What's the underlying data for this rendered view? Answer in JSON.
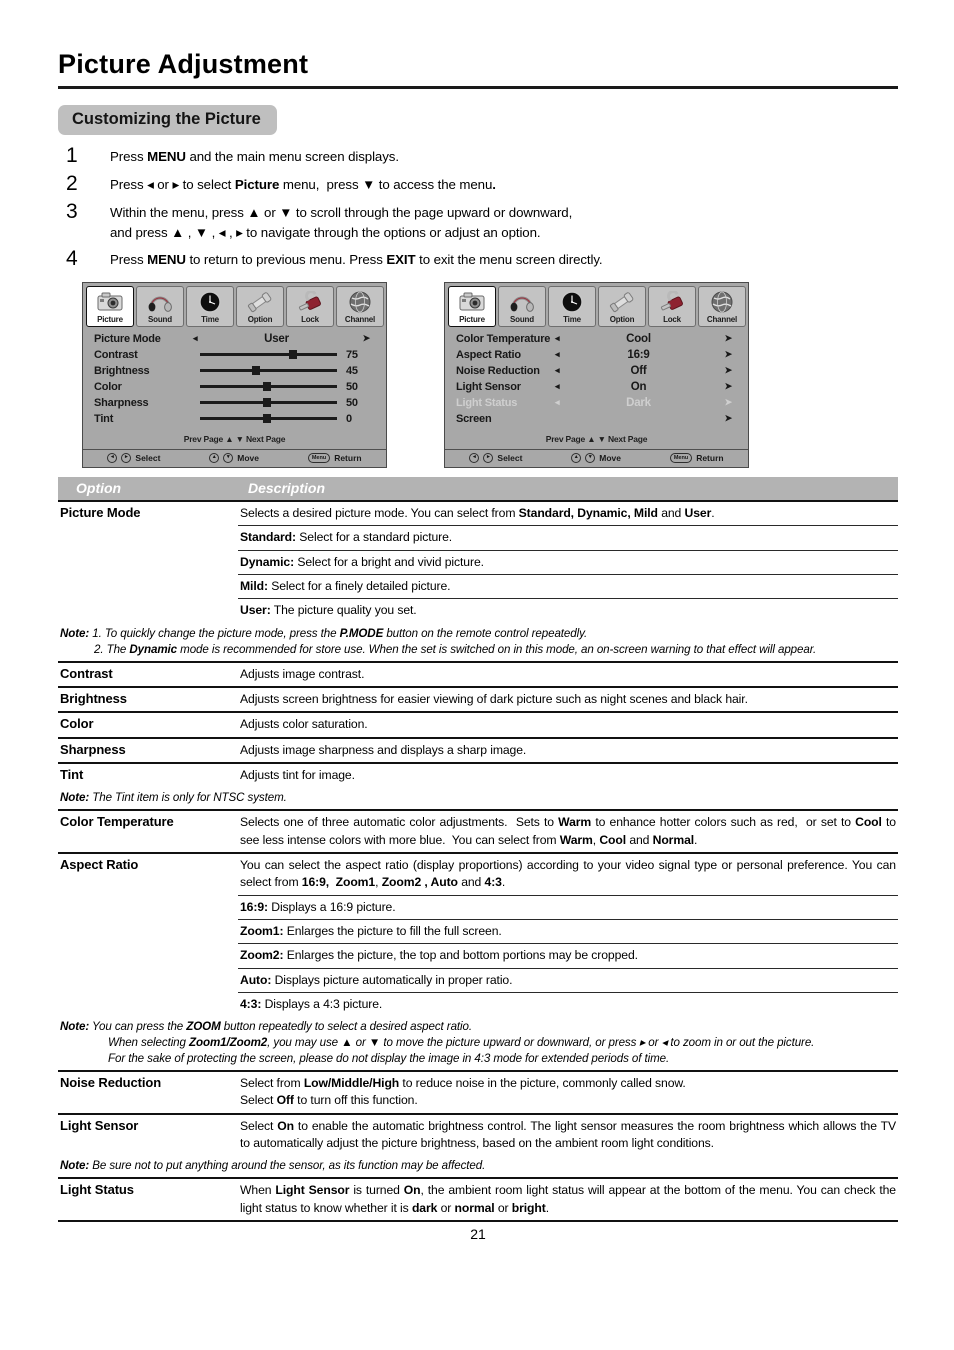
{
  "document": {
    "title": "Picture Adjustment",
    "section_heading": "Customizing the Picture",
    "page_number": "21"
  },
  "steps": [
    {
      "num": "1",
      "html": "Press <b>MENU</b> and the main menu screen displays."
    },
    {
      "num": "2",
      "html": "Press &#9666; or &#9656; to select <b>Picture</b> menu,&nbsp; press &#9660; to access the menu<b>.</b>"
    },
    {
      "num": "3",
      "html": "Within the menu, press &#9650; or &#9660; to scroll through the page upward or downward,<br>and press &#9650; , &#9660; , &#9666; , &#9656; to navigate through the options or adjust an option."
    },
    {
      "num": "4",
      "html": "Press <b>MENU</b> to return to previous menu. Press <b>EXIT</b> to exit the menu screen directly."
    }
  ],
  "osd": {
    "tabs": [
      {
        "label": "Picture",
        "icon": "camera-icon",
        "active": true
      },
      {
        "label": "Sound",
        "icon": "headphones-icon",
        "active": false
      },
      {
        "label": "Time",
        "icon": "clock-icon",
        "active": false
      },
      {
        "label": "Option",
        "icon": "tools-icon",
        "active": false
      },
      {
        "label": "Lock",
        "icon": "padlock-icon",
        "active": false
      },
      {
        "label": "Channel",
        "icon": "globe-icon",
        "active": false
      }
    ],
    "paging": "Prev  Page ▲  ▼ Next  Page",
    "footer": {
      "select_label": "Select",
      "select_keys": [
        "◂",
        "▸"
      ],
      "move_label": "Move",
      "move_keys": [
        "▴",
        "▾"
      ],
      "return_label": "Return",
      "return_key": "Menu"
    },
    "screen1": {
      "rows": [
        {
          "label": "Picture Mode",
          "type": "choice",
          "value": "User"
        },
        {
          "label": "Contrast",
          "type": "slider",
          "value": "75",
          "pct": 68
        },
        {
          "label": "Brightness",
          "type": "slider",
          "value": "45",
          "pct": 41
        },
        {
          "label": "Color",
          "type": "slider",
          "value": "50",
          "pct": 49
        },
        {
          "label": "Sharpness",
          "type": "slider",
          "value": "50",
          "pct": 49
        },
        {
          "label": "Tint",
          "type": "slider",
          "value": "0",
          "pct": 49
        }
      ]
    },
    "screen2": {
      "rows": [
        {
          "label": "Color Temperature",
          "type": "choice",
          "value": "Cool",
          "dim": false
        },
        {
          "label": "Aspect Ratio",
          "type": "choice",
          "value": "16:9",
          "dim": false
        },
        {
          "label": "Noise Reduction",
          "type": "choice",
          "value": "Off",
          "dim": false
        },
        {
          "label": "Light Sensor",
          "type": "choice",
          "value": "On",
          "dim": false
        },
        {
          "label": "Light Status",
          "type": "choice",
          "value": "Dark",
          "dim": true
        },
        {
          "label": "Screen",
          "type": "submenu",
          "value": "",
          "dim": false
        }
      ]
    }
  },
  "table": {
    "headers": {
      "option": "Option",
      "description": "Description"
    },
    "rows": [
      {
        "option": "Picture Mode",
        "lines": [
          "Selects a desired picture mode. You can select from <b>Standard, Dynamic, Mild</b> and <b>User</b>.",
          "<b>Standard:</b> Select for a standard picture.",
          "<b>Dynamic:</b> Select for a bright and vivid picture.",
          "<b>Mild:</b> Select for a finely detailed picture.",
          "<b>User:</b> The picture quality you set."
        ],
        "note": "<span class=\"nb\">Note:</span> 1. To quickly change the picture mode, press the <b>P.MODE</b> button on the remote control repeatedly.<span class=\"note-hang\">2. The <b>Dynamic</b> mode is recommended for store use. When the set is switched on in this mode, an on-screen warning to that effect will appear.</span>"
      },
      {
        "option": "Contrast",
        "lines": [
          "Adjusts image contrast."
        ]
      },
      {
        "option": "Brightness",
        "lines": [
          "Adjusts screen brightness for easier viewing of dark picture such as night scenes and black hair."
        ]
      },
      {
        "option": "Color",
        "lines": [
          "Adjusts color saturation."
        ]
      },
      {
        "option": "Sharpness",
        "lines": [
          " Adjusts image sharpness and displays a sharp image."
        ]
      },
      {
        "option": "Tint",
        "lines": [
          "Adjusts tint for image."
        ],
        "note": "<span class=\"nb\">Note:</span> The Tint item is only for NTSC system."
      },
      {
        "option": "Color Temperature",
        "lines": [
          "Selects one of three automatic color adjustments.&nbsp; Sets to <b>Warm</b> to enhance hotter colors such as red,&nbsp; or set to <b>Cool</b> to see less intense colors with more blue.&nbsp; You can select from <b>Warm</b>, <b>Cool</b> and <b>Normal</b>."
        ]
      },
      {
        "option": "Aspect Ratio",
        "lines": [
          "You can select the aspect ratio (display proportions) according to your video signal type or personal preference. You can select from <b>16:9,&nbsp; Zoom1</b>, <b>Zoom2 , Auto</b> and <b>4:3</b>.",
          "<b>16:9:</b> Displays a 16:9 picture.",
          "<b>Zoom1:</b> Enlarges the picture to fill the full screen.",
          "<b>Zoom2:</b> Enlarges the picture, the top and bottom portions may be cropped.",
          "<b>Auto:</b> Displays picture automatically in proper ratio.",
          "<b>4:3:</b> Displays a 4:3 picture."
        ],
        "note": "<span class=\"nb\">Note:</span> You can press the <b>ZOOM</b> button repeatedly to select a desired aspect ratio.<span class=\"note-indent\">When selecting <b>Zoom1/Zoom2</b>, you may use &#9650; or &#9660; to move the picture upward or downward, or press &#9656; or &#9666; to zoom in or out the picture.</span><span class=\"note-indent\">For the sake of protecting the screen, please do not display the image in 4:3 mode for extended periods of time.</span>"
      },
      {
        "option": "Noise Reduction",
        "lines": [
          "Select from <b>Low/Middle/High</b> to reduce noise in the picture, commonly called snow.<br>Select <b>Off</b> to turn off this function."
        ]
      },
      {
        "option": "Light Sensor",
        "lines": [
          "Select <b>On</b> to enable the automatic brightness control. The light sensor measures the room brightness which allows the TV to automatically adjust the picture brightness, based on the ambient room light conditions."
        ],
        "note": "<span class=\"nb\">Note:</span> Be sure not to put anything around the sensor, as its function may be affected."
      },
      {
        "option": "Light Status",
        "lines": [
          "When <b>Light Sensor</b> is turned <b>On</b>, the ambient room light status will appear at the bottom of the menu. You can check the light status to know whether it is <b>dark</b> or <b>normal</b> or <b>bright</b>."
        ]
      }
    ]
  }
}
